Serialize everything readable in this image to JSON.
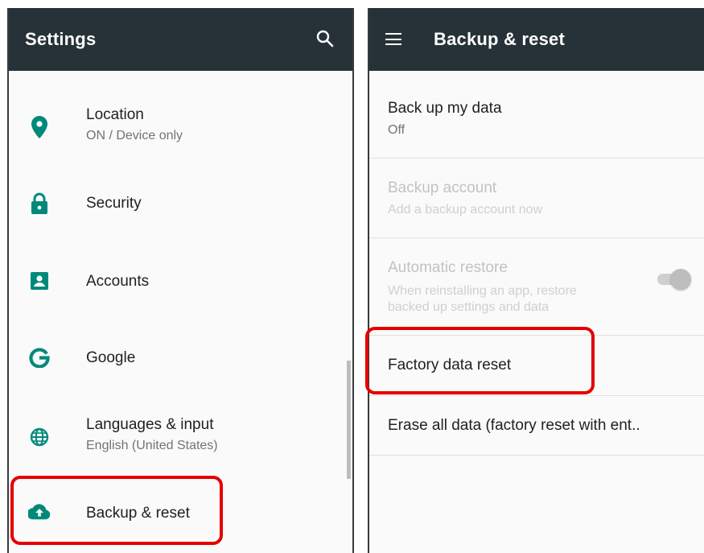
{
  "left": {
    "title": "Settings",
    "items": [
      {
        "label": "Location",
        "sub": "ON / Device only",
        "icon": "location-pin-icon"
      },
      {
        "label": "Security",
        "icon": "lock-icon"
      },
      {
        "label": "Accounts",
        "icon": "account-box-icon"
      },
      {
        "label": "Google",
        "icon": "google-icon"
      },
      {
        "label": "Languages & input",
        "sub": "English (United States)",
        "icon": "globe-icon"
      },
      {
        "label": "Backup & reset",
        "icon": "cloud-upload-icon"
      }
    ]
  },
  "right": {
    "title": "Backup & reset",
    "items": [
      {
        "label": "Back up my data",
        "sub": "Off"
      },
      {
        "label": "Backup account",
        "sub": "Add a backup account now"
      },
      {
        "label": "Automatic restore",
        "sub": "When reinstalling an app, restore backed up settings and data",
        "sub_line1": "When reinstalling an app, restore",
        "sub_line2": "backed up settings and data"
      },
      {
        "label": "Factory data reset"
      },
      {
        "label": "Erase all data (factory reset with ent.."
      }
    ]
  },
  "colors": {
    "appbar": "#263238",
    "icon_teal": "#00897b",
    "highlight": "#e50000"
  }
}
